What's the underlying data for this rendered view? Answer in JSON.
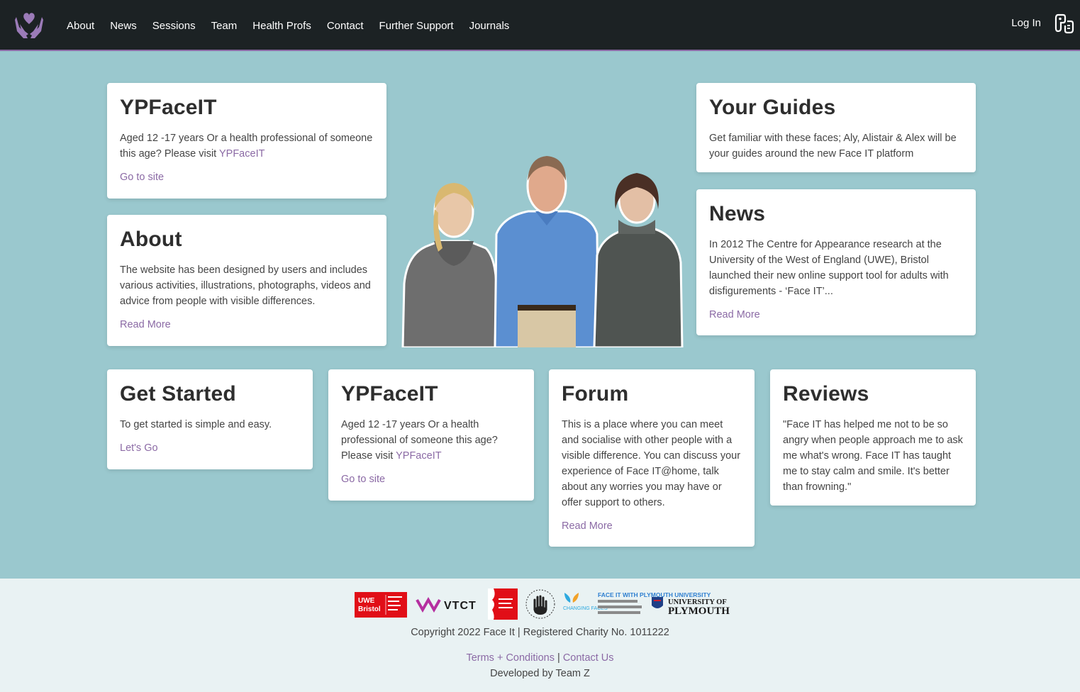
{
  "nav": {
    "items": [
      {
        "label": "About"
      },
      {
        "label": "News"
      },
      {
        "label": "Sessions"
      },
      {
        "label": "Team"
      },
      {
        "label": "Health Profs"
      },
      {
        "label": "Contact"
      },
      {
        "label": "Further Support"
      },
      {
        "label": "Journals"
      }
    ],
    "login_label": "Log In",
    "logo_icon": "hands-heart-icon",
    "accessibility_icon": "accessibility-icon"
  },
  "cards": {
    "ypfaceit_top": {
      "title": "YPFaceIT",
      "text_before": "Aged 12 -17 years Or a health professional of someone this age? Please visit ",
      "inline_link": "YPFaceIT",
      "link": "Go to site"
    },
    "about": {
      "title": "About",
      "text": "The website has been designed by users and includes various activities, illustrations, photographs, videos and advice from people with visible differences.",
      "link": "Read More"
    },
    "guides": {
      "title": "Your Guides",
      "text": "Get familiar with these faces; Aly, Alistair & Alex will be your guides around the new Face IT platform"
    },
    "news": {
      "title": "News",
      "text": "In 2012 The Centre for Appearance research at the University of the West of England (UWE), Bristol launched their new online support tool for adults with disfigurements - ‘Face IT’...",
      "link": "Read More"
    },
    "get_started": {
      "title": "Get Started",
      "text": "To get started is simple and easy.",
      "link": "Let's Go"
    },
    "ypfaceit_bottom": {
      "title": "YPFaceIT",
      "text_before": "Aged 12 -17 years Or a health professional of someone this age? Please visit ",
      "inline_link": "YPFaceIT",
      "link": "Go to site"
    },
    "forum": {
      "title": "Forum",
      "text": "This is a place where you can meet and socialise with other people with a visible difference. You can discuss your experience of Face IT@home, talk about any worries you may have or offer support to others.",
      "link": "Read More"
    },
    "reviews": {
      "title": "Reviews",
      "text": "\"Face IT has helped me not to be so angry when people approach me to ask me what's wrong. Face IT has taught me to stay calm and smile. It's better than frowning.\""
    }
  },
  "footer": {
    "logos": {
      "uwe_line1": "UWE",
      "uwe_line2": "Bristol",
      "vtct": "VTCT",
      "changing_faces": "CHANGING FACES",
      "faceit_plymouth": "FACE IT WITH PLYMOUTH UNIVERSITY",
      "plymouth_line1": "UNIVERSITY OF",
      "plymouth_line2": "PLYMOUTH"
    },
    "copyright": "Copyright 2022 Face It | Registered Charity No. 1011222",
    "terms_link": "Terms + Conditions",
    "separator": "|",
    "contact_link": "Contact Us",
    "developed": "Developed by Team Z"
  },
  "colors": {
    "background": "#9ac8ce",
    "navbar": "#1c2224",
    "accent": "#8b6aa5",
    "footer": "#e9f2f3"
  }
}
